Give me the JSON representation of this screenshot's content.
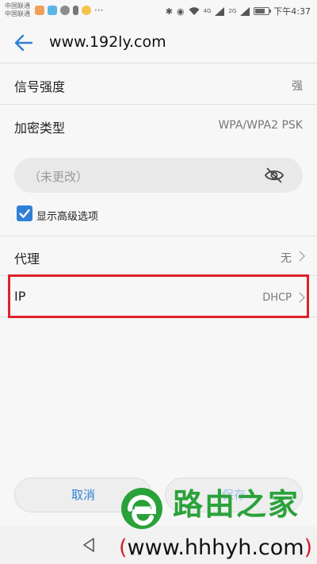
{
  "status_bar": {
    "carrier_1": "中国联通",
    "carrier_2": "中国联通",
    "dots": "···",
    "network_1": "4G",
    "network_2": "2G",
    "time": "下午4:37"
  },
  "header": {
    "title": "www.192ly.com"
  },
  "rows": {
    "signal": {
      "label": "信号强度",
      "value": "强"
    },
    "security": {
      "label": "加密类型",
      "value": "WPA/WPA2 PSK"
    },
    "proxy": {
      "label": "代理",
      "value": "无"
    },
    "ip": {
      "label": "IP",
      "value": "DHCP"
    }
  },
  "password": {
    "placeholder": "（未更改）"
  },
  "advanced": {
    "label": "显示高级选项",
    "checked": true
  },
  "buttons": {
    "cancel": "取消",
    "save": "保存"
  },
  "watermark": {
    "brand": "路由之家",
    "url": "www.hhhyh.com"
  },
  "colors": {
    "accent": "#2f80d6",
    "highlight": "#e0202a",
    "brand_green": "#2aa23a"
  }
}
